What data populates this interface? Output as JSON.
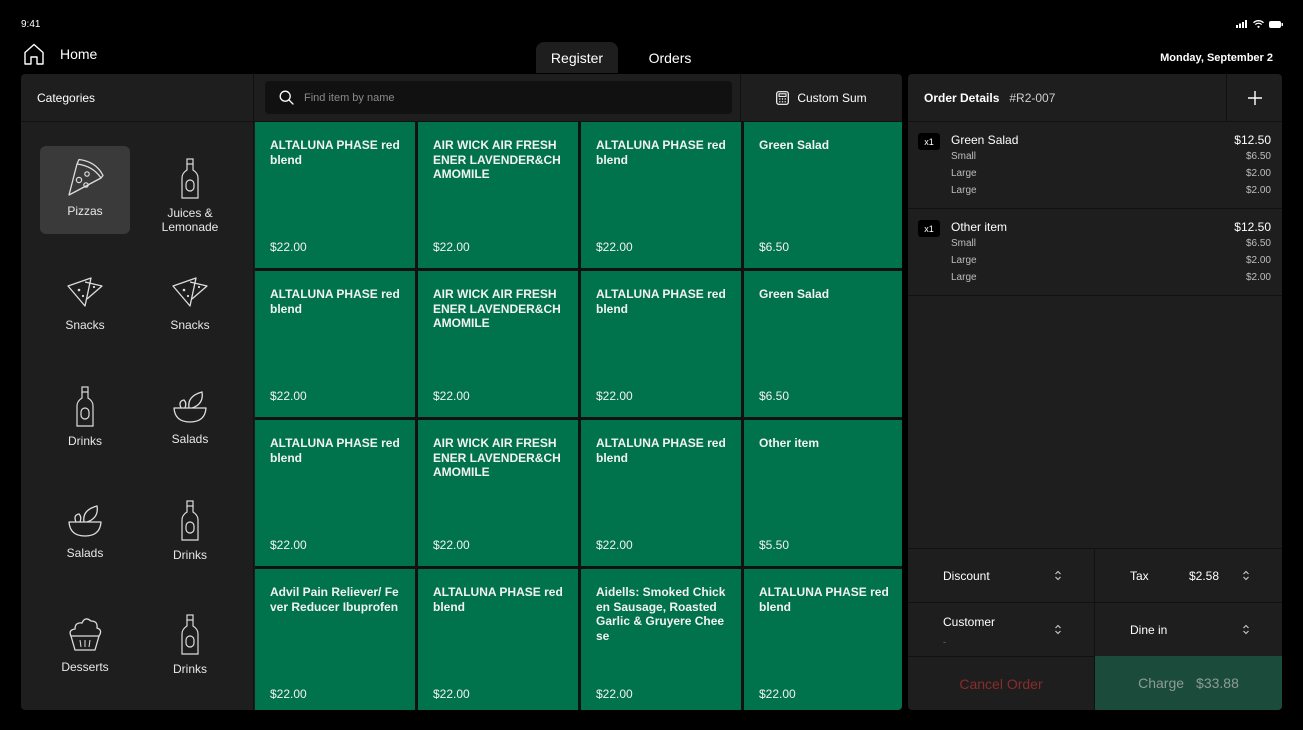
{
  "status_bar": {
    "time": "9:41"
  },
  "nav": {
    "home_label": "Home",
    "tabs": [
      {
        "label": "Register",
        "active": true
      },
      {
        "label": "Orders",
        "active": false
      }
    ],
    "date": "Monday, September 2"
  },
  "categories": {
    "header": "Categories",
    "items": [
      {
        "label": "Pizzas",
        "icon": "pizza-icon",
        "active": true
      },
      {
        "label": "Juices & Lemonade",
        "icon": "bottle-icon"
      },
      {
        "label": "Snacks",
        "icon": "nachos-icon"
      },
      {
        "label": "Snacks",
        "icon": "nachos-icon"
      },
      {
        "label": "Drinks",
        "icon": "bottle-icon"
      },
      {
        "label": "Salads",
        "icon": "salad-bowl-icon"
      },
      {
        "label": "Salads",
        "icon": "salad-bowl-icon"
      },
      {
        "label": "Drinks",
        "icon": "bottle-icon"
      },
      {
        "label": "Desserts",
        "icon": "dessert-icon"
      },
      {
        "label": "Drinks",
        "icon": "bottle-icon"
      }
    ]
  },
  "search": {
    "placeholder": "Find item by name"
  },
  "custom_sum": {
    "label": "Custom Sum"
  },
  "items": [
    {
      "name": "ALTALUNA PHASE red blend",
      "price": "$22.00"
    },
    {
      "name": "AIR WICK AIR FRESHENER LAVENDER&CHAMOMILE",
      "price": "$22.00"
    },
    {
      "name": "ALTALUNA PHASE red blend",
      "price": "$22.00"
    },
    {
      "name": "Green Salad",
      "price": "$6.50"
    },
    {
      "name": "ALTALUNA PHASE red blend",
      "price": "$22.00"
    },
    {
      "name": "AIR WICK AIR FRESHENER LAVENDER&CHAMOMILE",
      "price": "$22.00"
    },
    {
      "name": "ALTALUNA PHASE red blend",
      "price": "$22.00"
    },
    {
      "name": "Green Salad",
      "price": "$6.50"
    },
    {
      "name": "ALTALUNA PHASE red blend",
      "price": "$22.00"
    },
    {
      "name": "AIR WICK AIR FRESHENER LAVENDER&CHAMOMILE",
      "price": "$22.00"
    },
    {
      "name": "ALTALUNA PHASE red blend",
      "price": "$22.00"
    },
    {
      "name": "Other item",
      "price": "$5.50"
    },
    {
      "name": "Advil Pain Reliever/ Fever Reducer Ibuprofen",
      "price": "$22.00"
    },
    {
      "name": "ALTALUNA PHASE red blend",
      "price": "$22.00"
    },
    {
      "name": "Aidells: Smoked Chicken Sausage, Roasted Garlic & Gruyere Cheese",
      "price": "$22.00"
    },
    {
      "name": "ALTALUNA PHASE red blend",
      "price": "$22.00"
    }
  ],
  "order": {
    "title": "Order Details",
    "id": "#R2-007",
    "lines": [
      {
        "qty": "x1",
        "name": "Green Salad",
        "price": "$12.50",
        "modifiers": [
          {
            "name": "Small",
            "price": "$6.50"
          },
          {
            "name": "Large",
            "price": "$2.00"
          },
          {
            "name": "Large",
            "price": "$2.00"
          }
        ]
      },
      {
        "qty": "x1",
        "name": "Other item",
        "price": "$12.50",
        "modifiers": [
          {
            "name": "Small",
            "price": "$6.50"
          },
          {
            "name": "Large",
            "price": "$2.00"
          },
          {
            "name": "Large",
            "price": "$2.00"
          }
        ]
      }
    ],
    "discount_label": "Discount",
    "tax_label": "Tax",
    "tax_value": "$2.58",
    "customer_label": "Customer",
    "customer_value": "-",
    "dine_label": "Dine in",
    "cancel_label": "Cancel Order",
    "charge_label": "Charge",
    "charge_total": "$33.88"
  },
  "colors": {
    "item_tile": "#00724c",
    "charge_bg": "#1b4b3b",
    "cancel_text": "#8a2c2c",
    "panel_bg": "#1e1e1e"
  }
}
